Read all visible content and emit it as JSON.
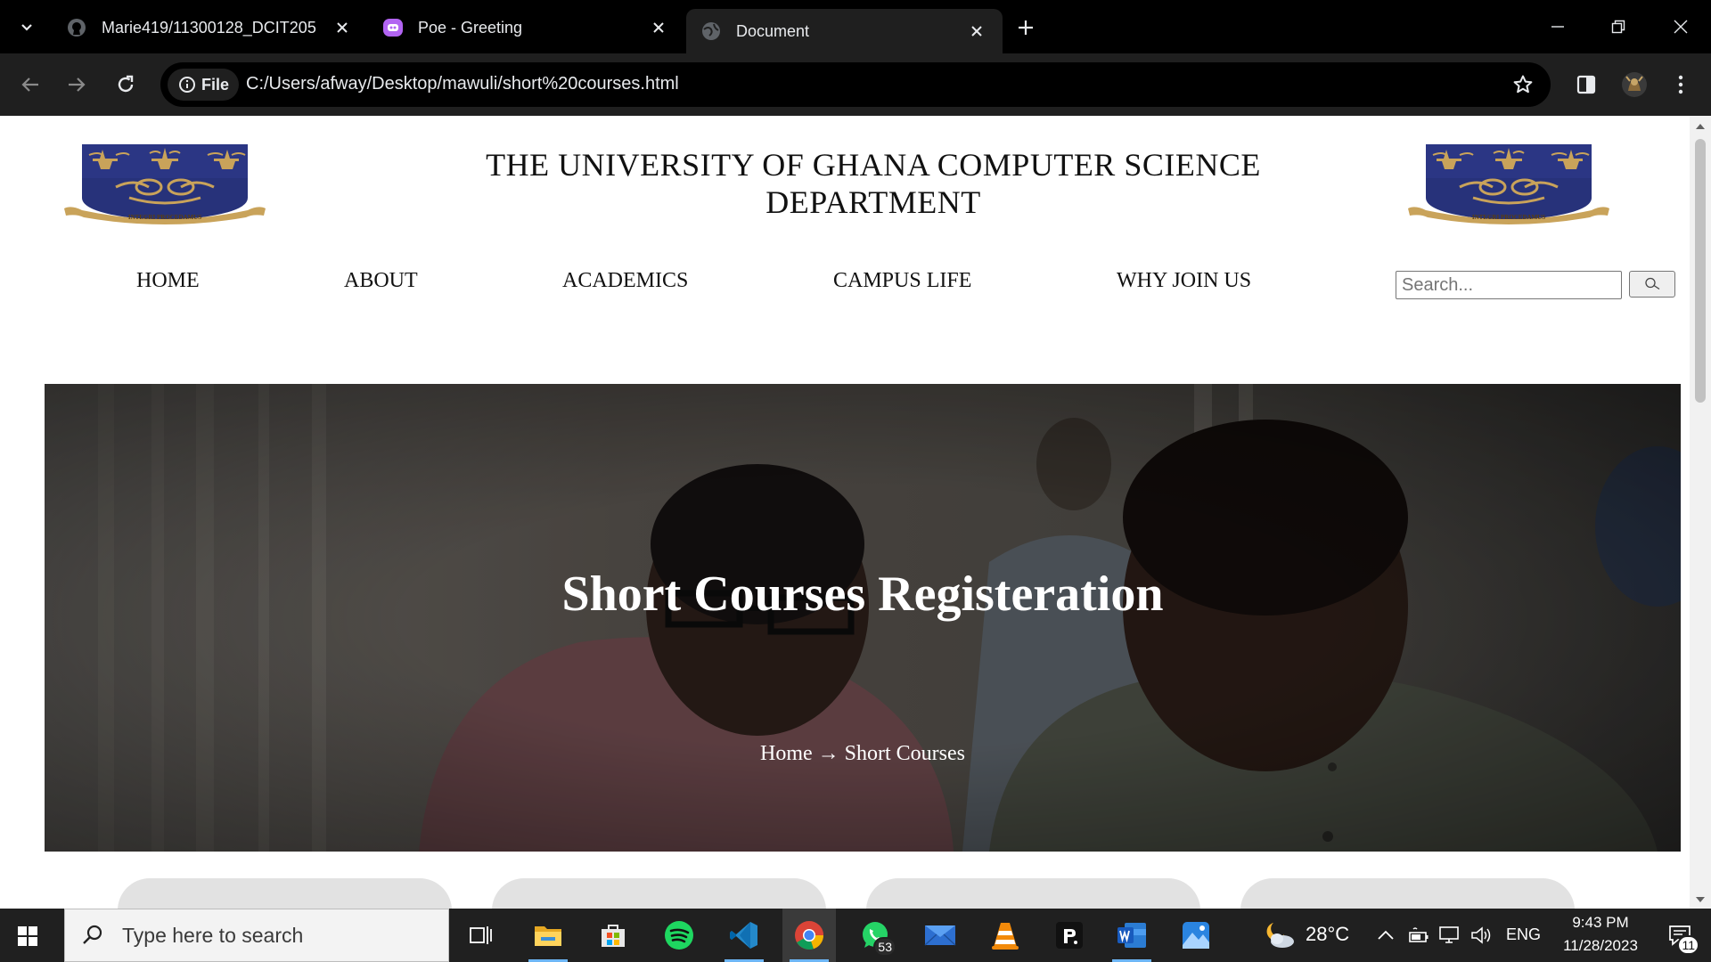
{
  "browser": {
    "tabs": [
      {
        "title": "Marie419/11300128_DCIT205",
        "icon": "github-icon",
        "active": false
      },
      {
        "title": "Poe - Greeting",
        "icon": "poe-icon",
        "active": false
      },
      {
        "title": "Document",
        "icon": "globe-icon",
        "active": true
      }
    ],
    "omnibox": {
      "chip_label": "File",
      "url": "C:/Users/afway/Desktop/mawuli/short%20courses.html"
    }
  },
  "page": {
    "site_title": "THE UNIVERSITY OF GHANA COMPUTER SCIENCE DEPARTMENT",
    "crest_motto": "INTEGRI PROCEDAMUS",
    "nav": [
      {
        "label": "HOME"
      },
      {
        "label": "ABOUT"
      },
      {
        "label": "ACADEMICS"
      },
      {
        "label": "CAMPUS LIFE"
      },
      {
        "label": "WHY JOIN US"
      }
    ],
    "search": {
      "placeholder": "Search...",
      "value": ""
    },
    "hero": {
      "title": "Short Courses Registeration",
      "breadcrumb": "Home → Short Courses"
    }
  },
  "taskbar": {
    "search_placeholder": "Type here to search",
    "apps": [
      {
        "name": "task-view-icon"
      },
      {
        "name": "file-explorer-icon"
      },
      {
        "name": "microsoft-store-icon"
      },
      {
        "name": "spotify-icon"
      },
      {
        "name": "vscode-icon"
      },
      {
        "name": "chrome-icon"
      },
      {
        "name": "whatsapp-icon",
        "badge": "53"
      },
      {
        "name": "mail-icon"
      },
      {
        "name": "vlc-icon"
      },
      {
        "name": "roblox-icon"
      },
      {
        "name": "word-icon"
      },
      {
        "name": "photos-icon"
      }
    ],
    "weather": "28°C",
    "language": "ENG",
    "time": "9:43 PM",
    "date": "11/28/2023",
    "notifications": "11"
  },
  "colors": {
    "crest_blue": "#27327a",
    "crest_gold": "#c9a35a",
    "chrome_dark": "#1f1f1f",
    "accent_blue": "#6db6f5"
  }
}
